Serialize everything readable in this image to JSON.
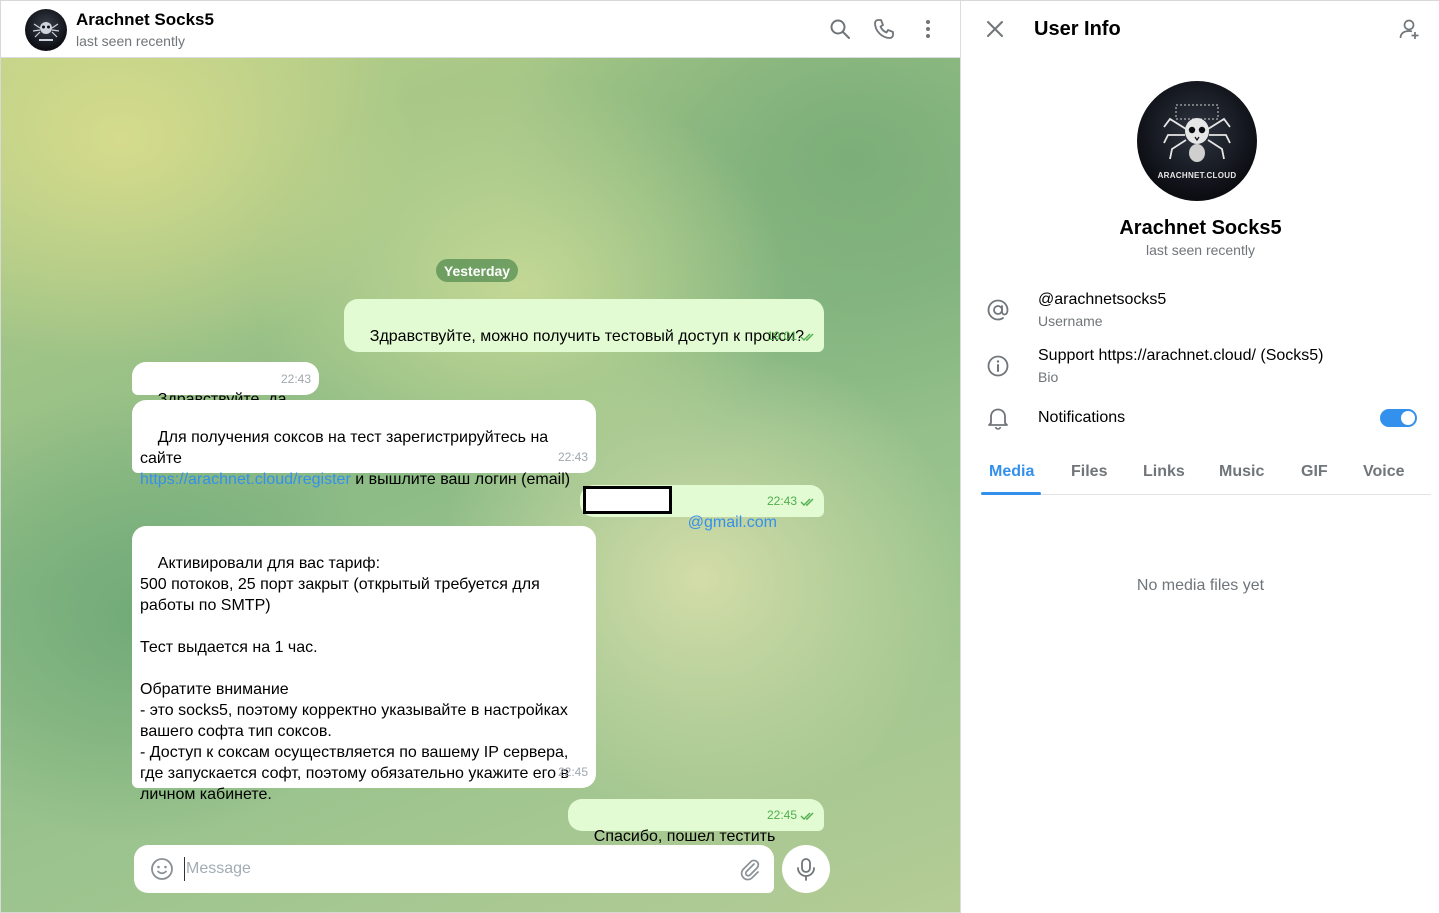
{
  "chat": {
    "name": "Arachnet Socks5",
    "status": "last seen recently",
    "avatar_text": "ARACHNET.CLOUD",
    "date_separator": "Yesterday",
    "messages": [
      {
        "dir": "out",
        "text": "Здравствуйте, можно получить тестовый доступ к прокси?",
        "time": "19:01"
      },
      {
        "dir": "in",
        "text": "Здравствуйте, да",
        "time": "22:43"
      },
      {
        "dir": "in",
        "text_before": "Для получения соксов на тест зарегистрируйтесь на сайте",
        "link": "https://arachnet.cloud/register",
        "text_after": " и вышлите ваш логин (email)",
        "time": "22:43"
      },
      {
        "dir": "out",
        "text": "@gmail.com",
        "time": "22:43"
      },
      {
        "dir": "in",
        "text": "Активировали для вас тариф:\n500 потоков, 25 порт закрыт (открытый требуется для работы по SMTP)\n\nТест выдается на 1 час.\n\nОбратите внимание\n- это socks5, поэтому корректно указывайте в настройках вашего софта тип соксов.\n- Доступ к соксам осуществляется по вашему IP сервера, где запускается софт, поэтому обязательно укажите его в личном кабинете.",
        "time": "22:45"
      },
      {
        "dir": "out",
        "text": "Спасибо, пошел тестить",
        "time": "22:45"
      }
    ],
    "composer_placeholder": "Message"
  },
  "info": {
    "title": "User Info",
    "name": "Arachnet Socks5",
    "status": "last seen recently",
    "avatar_text": "ARACHNET.CLOUD",
    "username_value": "@arachnetsocks5",
    "username_label": "Username",
    "bio_value": "Support https://arachnet.cloud/ (Socks5)",
    "bio_label": "Bio",
    "notifications_label": "Notifications",
    "notifications_on": true,
    "tabs": [
      "Media",
      "Files",
      "Links",
      "Music",
      "GIF",
      "Voice"
    ],
    "active_tab": "Media",
    "empty_text": "No media files yet"
  },
  "colors": {
    "accent": "#3390ec",
    "outgoing_bubble": "#e3fbd2",
    "check": "#4fae4e"
  }
}
